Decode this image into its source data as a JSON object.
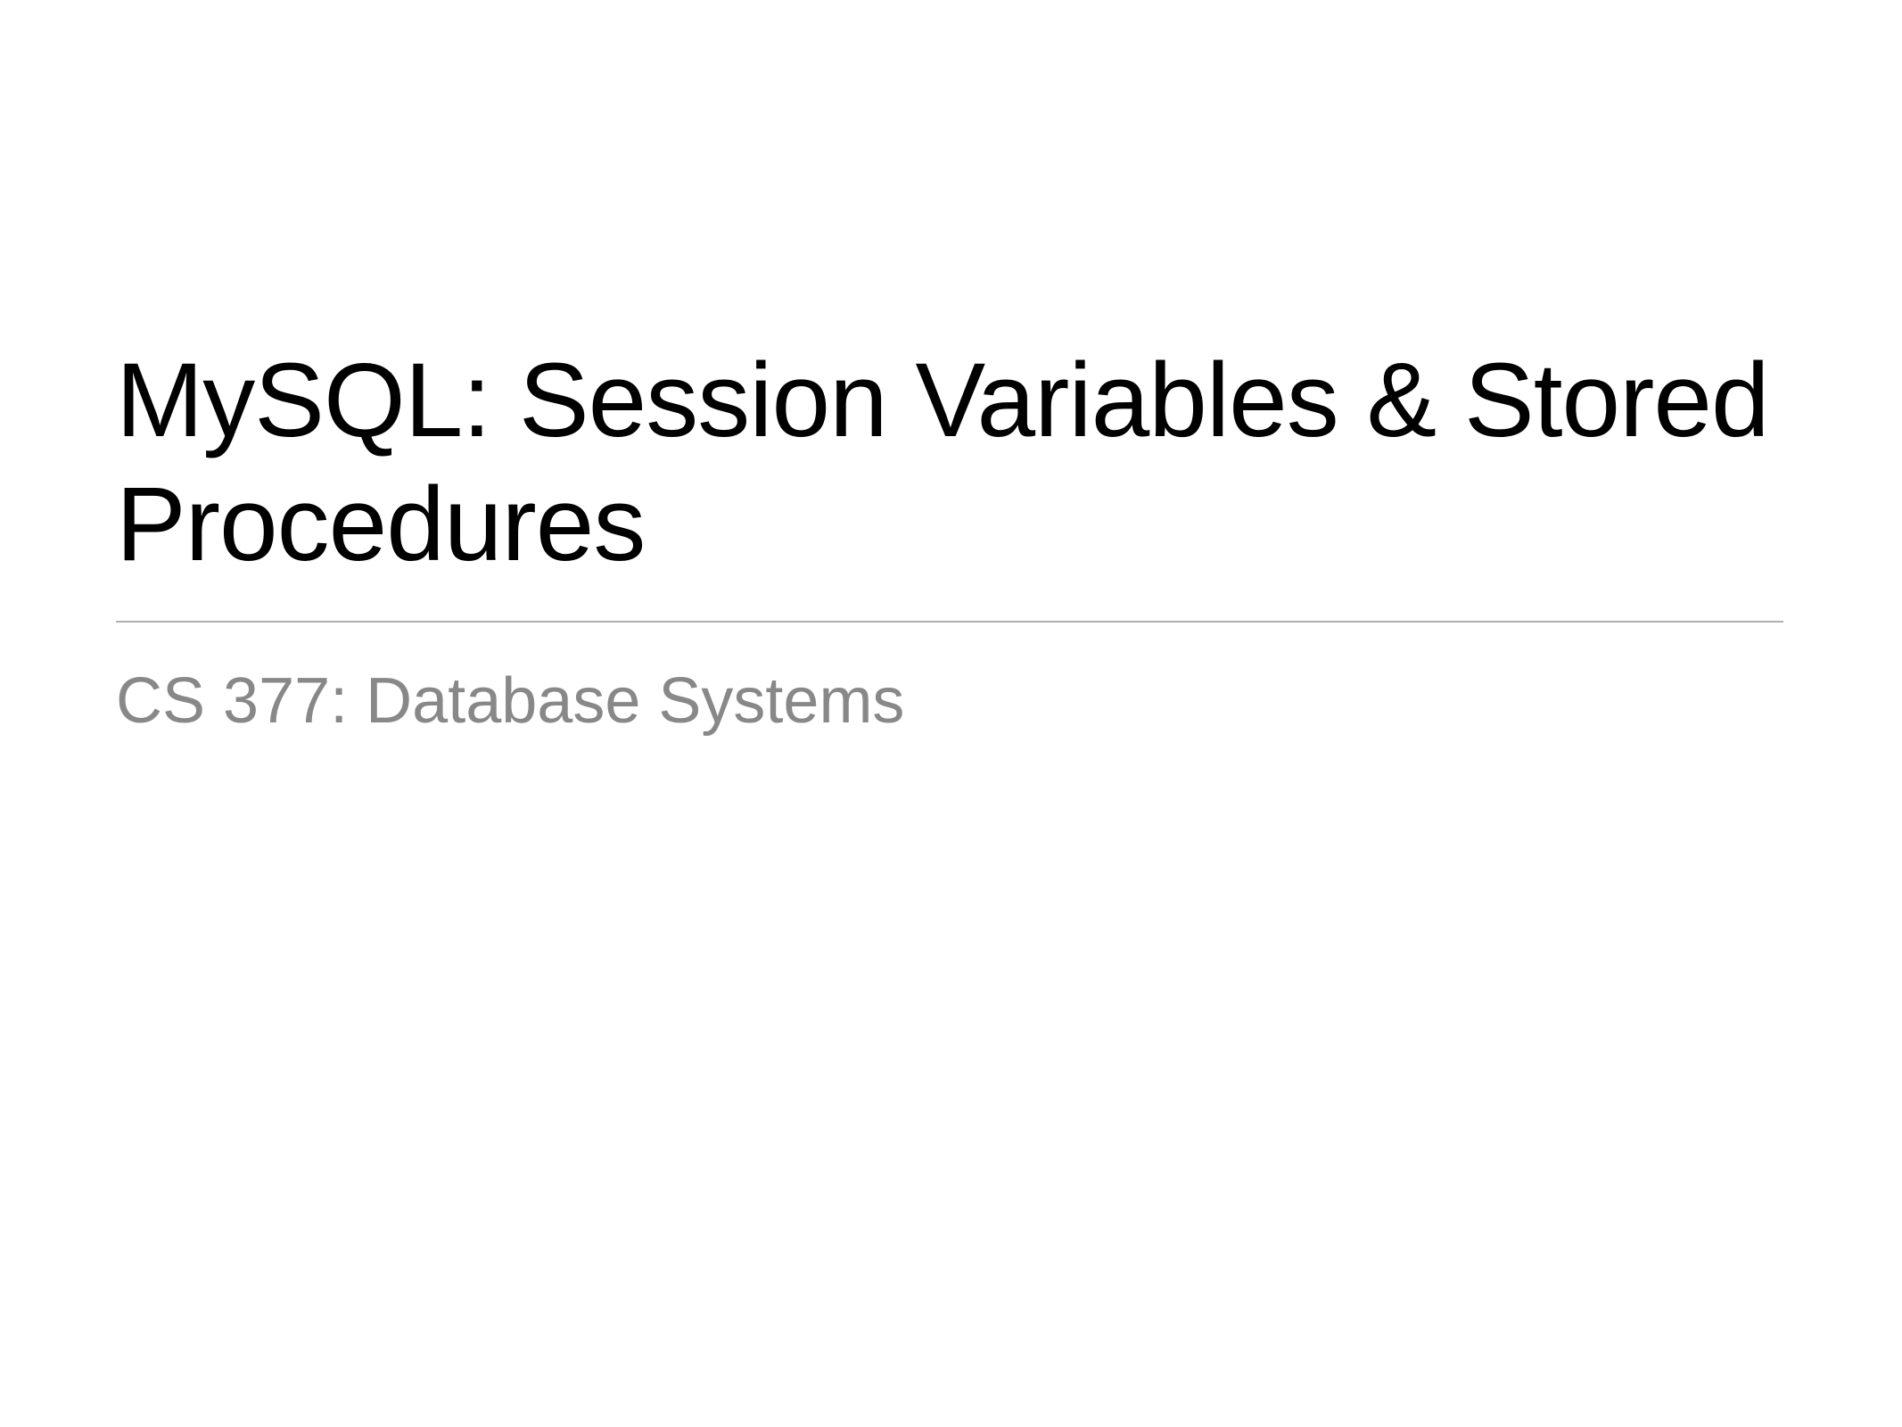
{
  "slide": {
    "title": "MySQL: Session Variables & Stored Procedures",
    "subtitle": "CS 377: Database Systems"
  }
}
